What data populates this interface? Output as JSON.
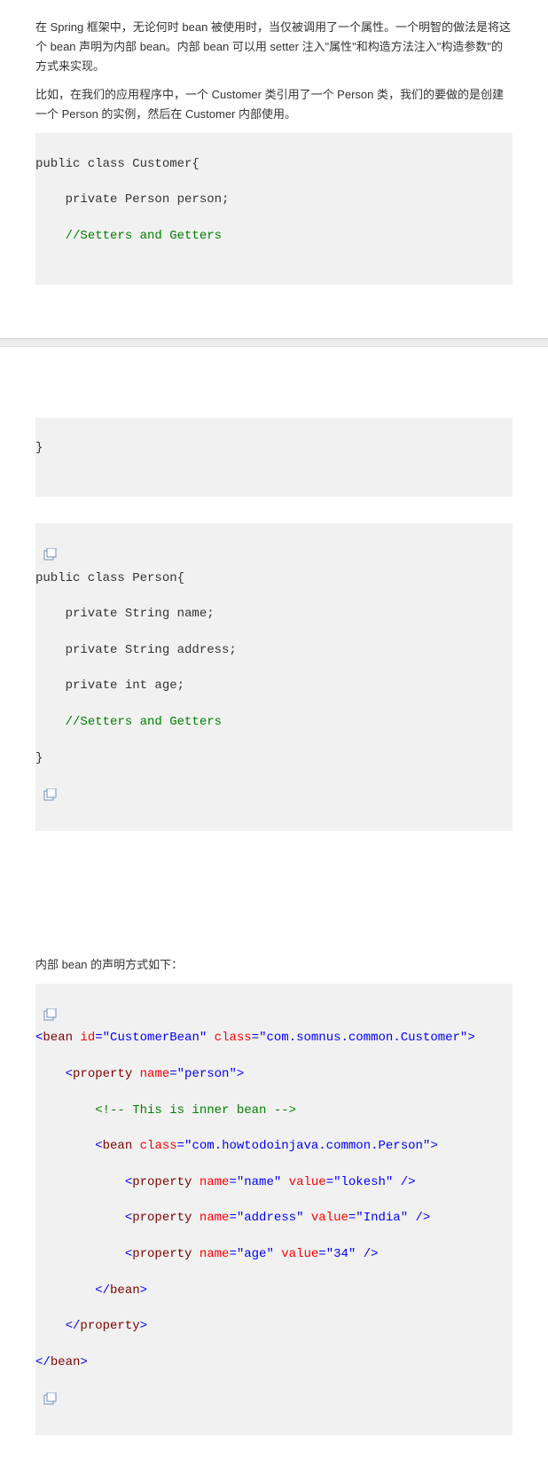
{
  "para1": "在 Spring 框架中，无论何时 bean 被使用时，当仅被调用了一个属性。一个明智的做法是将这个 bean 声明为内部 bean。内部 bean 可以用 setter 注入\"属性\"和构造方法注入\"构造参数\"的方式来实现。",
  "para2": "比如，在我们的应用程序中，一个 Customer 类引用了一个 Person 类，我们的要做的是创建一个 Person 的实例，然后在 Customer 内部使用。",
  "code1": {
    "l1": "public class Customer{",
    "l2": "    private Person person;",
    "l3_a": "    ",
    "l3_b": "//Setters and Getters"
  },
  "code2": {
    "close": "}",
    "l1": "public class Person{",
    "l2": "    private String name;",
    "l3": "    private String address;",
    "l4": "    private int age;",
    "l5_a": "    ",
    "l5_b": "//Setters and Getters",
    "l6": "}"
  },
  "para3": "内部 bean 的声明方式如下：",
  "code3": {
    "l1_a": "<",
    "l1_b": "bean ",
    "l1_c": "id",
    "l1_d": "=\"CustomerBean\"",
    "l1_e": " class",
    "l1_f": "=\"com.somnus.common.Customer\"",
    "l1_g": ">",
    "l2_a": "    <",
    "l2_b": "property ",
    "l2_c": "name",
    "l2_d": "=\"person\"",
    "l2_e": ">",
    "l3_a": "        ",
    "l3_b": "<!-- This is inner bean -->",
    "l4_a": "        <",
    "l4_b": "bean ",
    "l4_c": "class",
    "l4_d": "=\"com.howtodoinjava.common.Person\"",
    "l4_e": ">",
    "l5_a": "            <",
    "l5_b": "property ",
    "l5_c": "name",
    "l5_d": "=\"name\"",
    "l5_e": " value",
    "l5_f": "=\"lokesh\"",
    "l5_g": " />",
    "l6_a": "            <",
    "l6_b": "property ",
    "l6_c": "name",
    "l6_d": "=\"address\"",
    "l6_e": " value",
    "l6_f": "=\"India\"",
    "l6_g": " />",
    "l7_a": "            <",
    "l7_b": "property ",
    "l7_c": "name",
    "l7_d": "=\"age\"",
    "l7_e": " value",
    "l7_f": "=\"34\"",
    "l7_g": " />",
    "l8_a": "        </",
    "l8_b": "bean",
    "l8_c": ">",
    "l9_a": "    </",
    "l9_b": "property",
    "l9_c": ">",
    "l10_a": "</",
    "l10_b": "bean",
    "l10_c": ">"
  }
}
